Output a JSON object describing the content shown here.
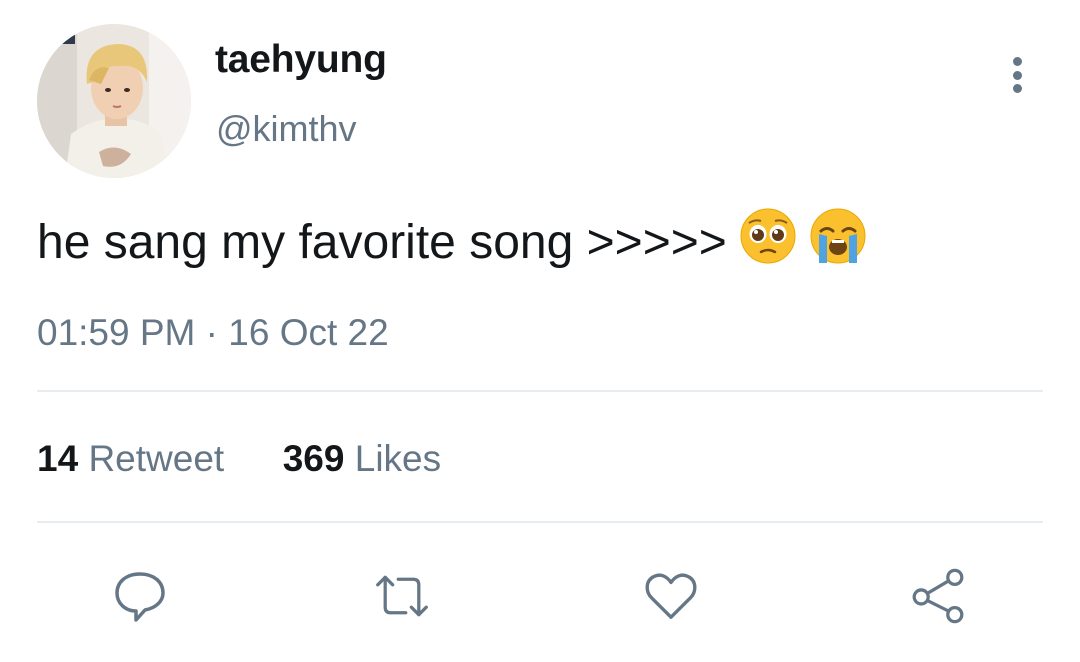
{
  "user": {
    "display_name": "taehyung",
    "handle": "@kimthv"
  },
  "tweet": {
    "text": "he sang my favorite song >>>>>",
    "emojis": [
      "pleading-face",
      "loudly-crying-face"
    ],
    "time": "01:59 PM",
    "separator": "·",
    "date": "16 Oct 22"
  },
  "stats": {
    "retweets": "14",
    "retweets_label": "Retweet",
    "likes": "369",
    "likes_label": "Likes"
  },
  "actions": [
    "reply-icon",
    "retweet-icon",
    "like-icon",
    "share-icon"
  ],
  "colors": {
    "primary_text": "#14171a",
    "secondary_text": "#657786",
    "divider": "#e6ecf0",
    "emoji_yellow": "#fbc02d"
  }
}
